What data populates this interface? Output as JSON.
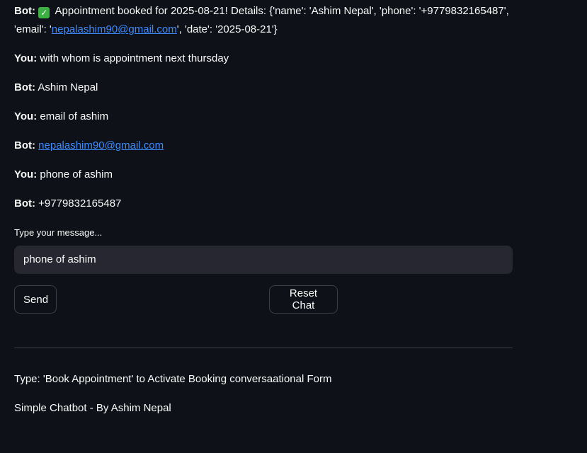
{
  "chat": [
    {
      "speaker": "Bot:",
      "pre": " Appointment booked for 2025-08-21! Details: {'name': 'Ashim Nepal', 'phone': '+9779832165487', 'email': '",
      "link": "nepalashim90@gmail.com",
      "post": "', 'date': '2025-08-21'}"
    },
    {
      "speaker": "You:",
      "text": " with whom is appointment next thursday"
    },
    {
      "speaker": "Bot:",
      "text": " Ashim Nepal"
    },
    {
      "speaker": "You:",
      "text": " email of ashim"
    },
    {
      "speaker": "Bot:",
      "link": "nepalashim90@gmail.com"
    },
    {
      "speaker": "You:",
      "text": " phone of ashim"
    },
    {
      "speaker": "Bot:",
      "text": " +9779832165487"
    }
  ],
  "input": {
    "label": "Type your message...",
    "value": "phone of ashim"
  },
  "buttons": {
    "send": "Send",
    "reset": "Reset Chat"
  },
  "footer": {
    "line1": "Type: 'Book Appointment' to Activate Booking conversaational Form",
    "line2": "Simple Chatbot - By Ashim Nepal"
  },
  "colors": {
    "background": "#0e1117",
    "text": "#fafafa",
    "link": "#3d8bfd",
    "input_bg": "#262730",
    "check": "#3cb043"
  },
  "icons": {
    "check": "white-check-mark-icon"
  }
}
